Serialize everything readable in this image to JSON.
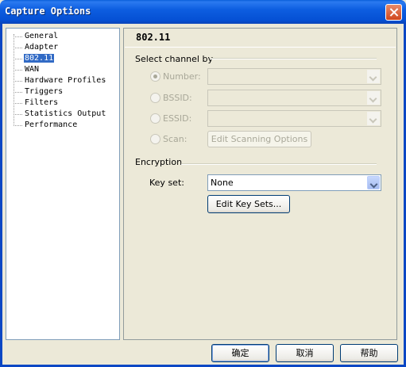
{
  "window": {
    "title": "Capture Options"
  },
  "tree": {
    "items": [
      {
        "label": "General",
        "selected": false
      },
      {
        "label": "Adapter",
        "selected": false
      },
      {
        "label": "802.11",
        "selected": true
      },
      {
        "label": "WAN",
        "selected": false
      },
      {
        "label": "Hardware Profiles",
        "selected": false
      },
      {
        "label": "Triggers",
        "selected": false
      },
      {
        "label": "Filters",
        "selected": false
      },
      {
        "label": "Statistics Output",
        "selected": false
      },
      {
        "label": "Performance",
        "selected": false
      }
    ]
  },
  "panel": {
    "title": "802.11",
    "channel_group": {
      "label": "Select channel by",
      "options": [
        {
          "label": "Number:",
          "checked": true,
          "enabled": false
        },
        {
          "label": "BSSID:",
          "checked": false,
          "enabled": false
        },
        {
          "label": "ESSID:",
          "checked": false,
          "enabled": false
        },
        {
          "label": "Scan:",
          "checked": false,
          "enabled": false
        }
      ],
      "scan_button_label": "Edit Scanning Options"
    },
    "encryption_group": {
      "label": "Encryption",
      "keyset_label": "Key set:",
      "keyset_value": "None",
      "edit_button_label": "Edit Key Sets..."
    }
  },
  "footer": {
    "ok_label": "确定",
    "cancel_label": "取消",
    "help_label": "帮助"
  }
}
